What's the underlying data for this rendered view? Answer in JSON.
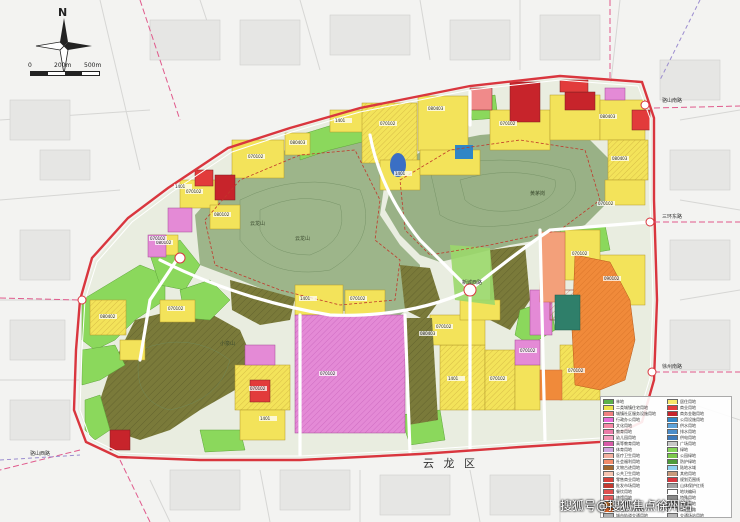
{
  "compass": {
    "north_label": "N",
    "icon": "compass-rose-icon"
  },
  "scale": {
    "ticks": [
      "0",
      "200m",
      "500m"
    ]
  },
  "district_label": "云 龙 区",
  "road_labels": [
    "骆山南路",
    "骆山西路",
    "徐州南路",
    "三环东路",
    "新城西路"
  ],
  "parcel_codes": {
    "c1": "070102",
    "c2": "080403",
    "c3": "070102",
    "c4": "080102",
    "c5": "1401",
    "c6": "070102",
    "c7": "080403",
    "c8": "1401",
    "c9": "070102",
    "c10": "080403",
    "c11": "080403",
    "c12": "080102",
    "c13": "1401",
    "c14": "070102",
    "c15": "1401",
    "c16": "070102",
    "c17": "080402",
    "c18": "070102",
    "c19": "1401",
    "c20": "070102",
    "c21": "070102",
    "c22": "090102",
    "c23": "070102",
    "c24": "070102",
    "c25": "070102",
    "c26": "1401",
    "c27": "070102",
    "c28": "080403",
    "c29": "070102",
    "c30": "070102"
  },
  "mountain_labels": [
    "云龙山",
    "云龙山",
    "小泉山",
    "黄茅岗"
  ],
  "legend_items": [
    {
      "label": "林地",
      "color": "#5bb04a"
    },
    {
      "label": "居住用地",
      "color": "#f7e86a"
    },
    {
      "label": "二类城镇住宅用地",
      "color": "#ece24a"
    },
    {
      "label": "商业用地",
      "color": "#e23b3b"
    },
    {
      "label": "城镇社区服务设施用地",
      "color": "#f08080"
    },
    {
      "label": "商务金融用地",
      "color": "#c7242b"
    },
    {
      "label": "行政办公用地",
      "color": "#e76bd8"
    },
    {
      "label": "公用设施用地",
      "color": "#2f86c6"
    },
    {
      "label": "文化用地",
      "color": "#f48aa5"
    },
    {
      "label": "供水用地",
      "color": "#5ea2d8"
    },
    {
      "label": "教育用地",
      "color": "#ea7ca8"
    },
    {
      "label": "排水用地",
      "color": "#4c8dc9"
    },
    {
      "label": "幼儿园用地",
      "color": "#f29fc0"
    },
    {
      "label": "供电用地",
      "color": "#3f79b8"
    },
    {
      "label": "高等教育用地",
      "color": "#d85ba8"
    },
    {
      "label": "广场用地",
      "color": "#c8c8c8"
    },
    {
      "label": "体育用地",
      "color": "#d0a7e0"
    },
    {
      "label": "绿地",
      "color": "#86d65a"
    },
    {
      "label": "医疗卫生用地",
      "color": "#f3b1a0"
    },
    {
      "label": "公园绿地",
      "color": "#7cc84c"
    },
    {
      "label": "社会福利用地",
      "color": "#f28c6a"
    },
    {
      "label": "防护绿地",
      "color": "#4f9a3a"
    },
    {
      "label": "文物古迹用地",
      "color": "#a0662e"
    },
    {
      "label": "陆地水域",
      "color": "#8fd0f0"
    },
    {
      "label": "公共卫生用地",
      "color": "#f6c4b0"
    },
    {
      "label": "其他用地",
      "color": "#c89a7a"
    },
    {
      "label": "零售商业用地",
      "color": "#d9403a"
    },
    {
      "label": "规划范围线",
      "color": "#d9363e"
    },
    {
      "label": "批发市场用地",
      "color": "#c43a30"
    },
    {
      "label": "山体保护红线",
      "color": "#a0a0a0"
    },
    {
      "label": "餐饮用地",
      "color": "#e05050"
    },
    {
      "label": "地块编码",
      "color": "#ffffff"
    },
    {
      "label": "旅馆用地",
      "color": "#e36060"
    },
    {
      "label": "特殊用地",
      "color": "#8a8a8a"
    },
    {
      "label": "娱乐康体用地",
      "color": "#ef8f3b"
    },
    {
      "label": "铁路用地",
      "color": "#9a9a9a"
    },
    {
      "label": "加油加气站用地",
      "color": "#ef7030"
    },
    {
      "label": "规划道路",
      "color": "#ffffff"
    },
    {
      "label": "城市轨道交通用地",
      "color": "#b0b0b0"
    },
    {
      "label": "交通场站用地",
      "color": "#b8b8b8"
    }
  ],
  "watermark": "搜狐号@搜狐焦点徐州站"
}
